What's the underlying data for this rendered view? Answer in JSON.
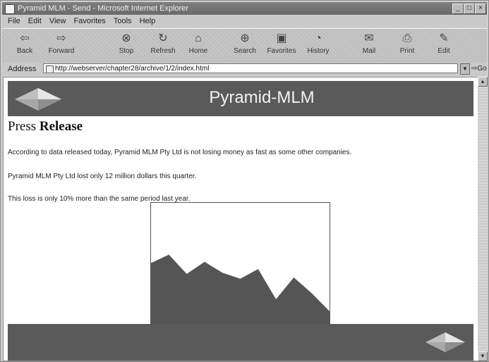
{
  "window": {
    "title": "Pyramid MLM - Send - Microsoft Internet Explorer"
  },
  "menu": {
    "items": [
      "File",
      "Edit",
      "View",
      "Favorites",
      "Tools",
      "Help"
    ]
  },
  "toolbar": {
    "back": "Back",
    "forward": "Forward",
    "stop": "Stop",
    "refresh": "Refresh",
    "home": "Home",
    "search": "Search",
    "favorites": "Favorites",
    "history": "History",
    "mail": "Mail",
    "print": "Print",
    "edit": "Edit"
  },
  "address": {
    "label": "Address",
    "url": "http://webserver/chapter28/archive/1/2/index.html",
    "go": "Go"
  },
  "page": {
    "site_title": "Pyramid-MLM",
    "heading_plain": "Press",
    "heading_bold": "Release",
    "para1": "According to data released today, Pyramid MLM Pty Ltd is not losing money as fast as some other companies.",
    "para2": "Pyramid MLM Pty Ltd lost only 12 million dollars this quarter.",
    "para3": "This loss is only 10% more than the same period last year."
  },
  "chart_data": {
    "type": "area",
    "x": [
      0,
      1,
      2,
      3,
      4,
      5,
      6,
      7,
      8,
      9,
      10
    ],
    "values": [
      50,
      57,
      41,
      51,
      42,
      37,
      45,
      20,
      38,
      25,
      10
    ],
    "ylim": [
      0,
      100
    ],
    "color": "#555555"
  },
  "colors": {
    "banner": "#5a5a5a",
    "banner_text": "#f2f2f2"
  }
}
